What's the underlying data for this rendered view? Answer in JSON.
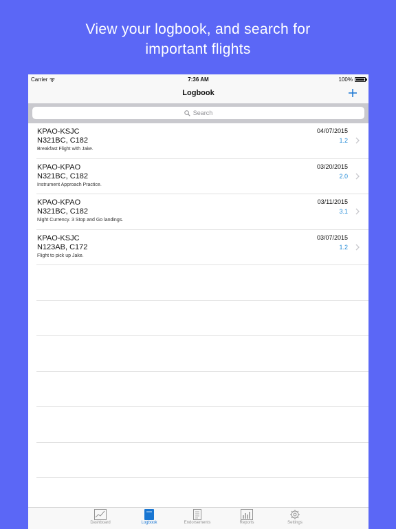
{
  "headline": {
    "line1": "View your logbook, and search for",
    "line2": "important flights"
  },
  "status_bar": {
    "carrier": "Carrier",
    "time": "7:36 AM",
    "battery": "100%"
  },
  "nav": {
    "title": "Logbook",
    "add_icon": "plus-icon"
  },
  "search": {
    "placeholder": "Search",
    "icon": "search-icon"
  },
  "flights": [
    {
      "route": "KPAO-KSJC",
      "aircraft": "N321BC, C182",
      "remarks": "Breakfast Flight with Jake.",
      "date": "04/07/2015",
      "hours": "1.2"
    },
    {
      "route": "KPAO-KPAO",
      "aircraft": "N321BC, C182",
      "remarks": "Instrument Approach Practice.",
      "date": "03/20/2015",
      "hours": "2.0"
    },
    {
      "route": "KPAO-KPAO",
      "aircraft": "N321BC, C182",
      "remarks": "Night Currency. 3 Stop and Go landings.",
      "date": "03/11/2015",
      "hours": "3.1"
    },
    {
      "route": "KPAO-KSJC",
      "aircraft": "N123AB, C172",
      "remarks": "Flight to pick up Jake.",
      "date": "03/07/2015",
      "hours": "1.2"
    }
  ],
  "tabs": [
    {
      "label": "Dashboard",
      "icon": "chart-icon"
    },
    {
      "label": "Logbook",
      "icon": "book-icon"
    },
    {
      "label": "Endorsements",
      "icon": "document-icon"
    },
    {
      "label": "Reports",
      "icon": "bar-chart-icon"
    },
    {
      "label": "Settings",
      "icon": "gear-icon"
    }
  ],
  "colors": {
    "background": "#5b67f6",
    "accent": "#1976d2",
    "hours": "#1e88d6"
  }
}
